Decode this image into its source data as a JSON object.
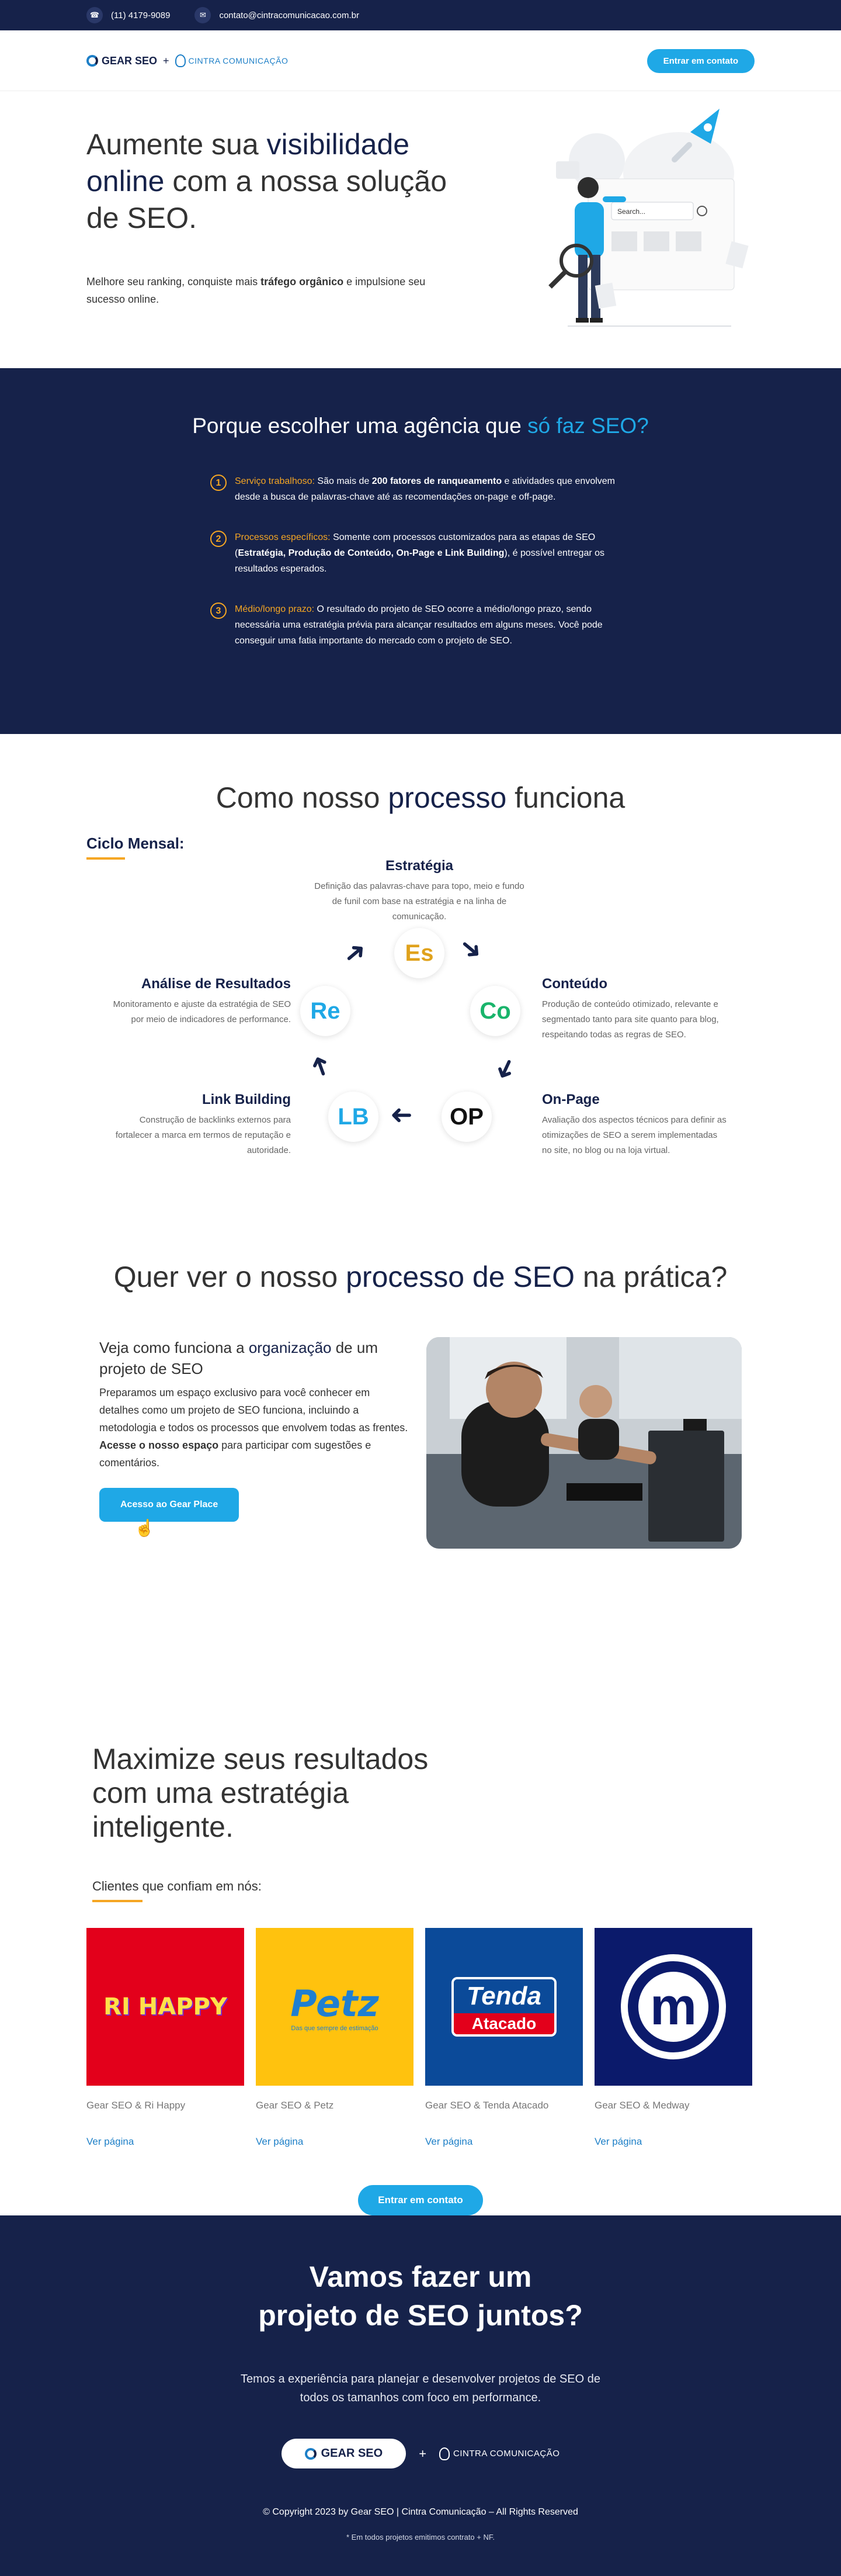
{
  "topbar": {
    "phone": "(11) 4179-9089",
    "email": "contato@cintracomunicacao.com.br"
  },
  "header": {
    "logo_gear": "GEAR SEO",
    "logo_plus": "+",
    "logo_cintra": "CINTRA COMUNICAÇÃO",
    "cta": "Entrar em contato"
  },
  "hero": {
    "title_1": "Aumente sua ",
    "title_hl_1": "visibilidade online",
    "title_2": " com a nossa solução de SEO.",
    "sub_1": "Melhore seu ranking, conquiste mais ",
    "sub_bold": "tráfego orgânico",
    "sub_2": " e impulsione seu sucesso online.",
    "search_placeholder": "Search..."
  },
  "why": {
    "title": "Porque escolher uma agência que ",
    "title_hl": "só faz SEO?",
    "items": [
      {
        "num": "1",
        "label": "Serviço trabalhoso:",
        "t1": " São mais de ",
        "bold": "200 fatores de ranqueamento",
        "t2": " e atividades que envolvem desde a busca de palavras-chave até as recomendações on-page e off-page."
      },
      {
        "num": "2",
        "label": "Processos específicos:",
        "t1": " Somente com processos customizados para as etapas de SEO (",
        "bold": "Estratégia, Produção de Conteúdo, On-Page e Link Building",
        "t2": "), é possível entregar os resultados esperados."
      },
      {
        "num": "3",
        "label": "Médio/longo prazo:",
        "t1": " O resultado do projeto de SEO ocorre a médio/longo prazo, sendo necessária uma estratégia prévia para alcançar resultados em alguns meses. Você pode conseguir uma fatia importante do mercado com o projeto de SEO.",
        "bold": "",
        "t2": ""
      }
    ]
  },
  "process": {
    "title_1": "Como nosso ",
    "title_hl": "processo",
    "title_2": " funciona",
    "ciclo": "Ciclo Mensal:",
    "steps": {
      "es": {
        "abbr": "Es",
        "name": "Estratégia",
        "desc": "Definição das palavras-chave para topo, meio e fundo de funil com base na estratégia e na linha de comunicação.",
        "color": "#e0a21c"
      },
      "co": {
        "abbr": "Co",
        "name": "Conteúdo",
        "desc": "Produção de conteúdo otimizado, relevante e segmentado tanto para site quanto para blog, respeitando todas as regras de SEO.",
        "color": "#19b46b"
      },
      "op": {
        "abbr": "OP",
        "name": "On-Page",
        "desc": "Avaliação dos aspectos técnicos para definir as otimizações de SEO a serem implementadas no site, no blog ou na loja virtual.",
        "color": "#111111"
      },
      "lb": {
        "abbr": "LB",
        "name": "Link Building",
        "desc": "Construção de backlinks externos para fortalecer a marca em termos de reputação e autoridade.",
        "color": "#1fa8e6"
      },
      "re": {
        "abbr": "Re",
        "name": "Análise de Resultados",
        "desc": "Monitoramento e ajuste da estratégia de SEO por meio de indicadores de performance.",
        "color": "#1fa8e6"
      }
    }
  },
  "practice": {
    "title_1": "Quer ver o nosso ",
    "title_hl": "processo de SEO",
    "title_2": " na prática?",
    "sub_1": "Veja como funciona a ",
    "sub_hl": "organização",
    "sub_2": " de um projeto de SEO",
    "desc_1": "Preparamos um espaço exclusivo para você conhecer em detalhes como um projeto de SEO funciona, incluindo a metodologia e todos os processos que envolvem todas as frentes. ",
    "desc_bold": "Acesse o nosso espaço",
    "desc_2": " para participar com sugestões e comentários.",
    "cta": "Acesso ao Gear Place"
  },
  "clients": {
    "title": "Maximize seus resultados com uma estratégia inteligente.",
    "subtitle": "Clientes que confiam em nós:",
    "cards": [
      {
        "logo": "RI HAPPY",
        "name": "Gear SEO & Ri Happy",
        "link": "Ver página",
        "bg": "#e3001b"
      },
      {
        "logo": "Petz",
        "tagline": "Das que sempre de estimação",
        "name": "Gear SEO & Petz",
        "link": "Ver página",
        "bg": "#ffc20e"
      },
      {
        "logo_top": "Tenda",
        "logo_bottom": "Atacado",
        "name": "Gear SEO & Tenda Atacado",
        "link": "Ver página",
        "bg": "#0b4a99"
      },
      {
        "logo": "m",
        "name": "Gear SEO & Medway",
        "link": "Ver página",
        "bg": "#0b1a6b"
      }
    ],
    "cta": "Entrar em contato"
  },
  "footer": {
    "title_1": "Vamos fazer um",
    "title_2": "projeto de SEO juntos?",
    "text_1": "Temos a experiência para planejar e desenvolver projetos de SEO de",
    "text_2": "todos os tamanhos com foco em performance.",
    "logo_gear": "GEAR SEO",
    "plus": "+",
    "logo_cintra": "CINTRA COMUNICAÇÃO",
    "copyright": "© Copyright 2023 by Gear SEO | Cintra Comunicação – All Rights Reserved",
    "note": "* Em todos projetos emitimos contrato + NF."
  }
}
